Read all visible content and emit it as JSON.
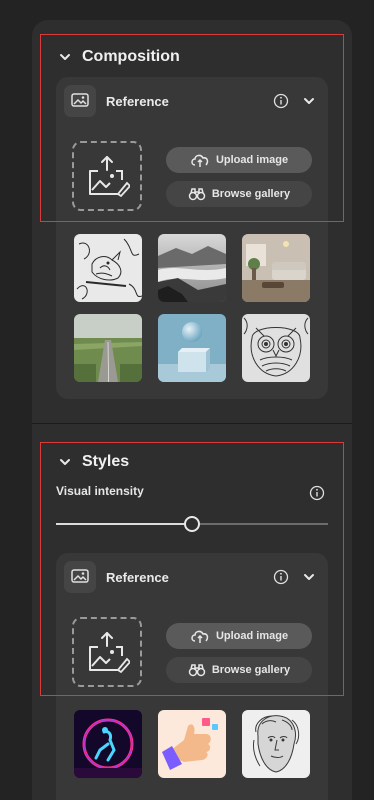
{
  "composition": {
    "title": "Composition",
    "reference": {
      "label": "Reference",
      "upload_label": "Upload image",
      "browse_label": "Browse gallery"
    },
    "thumbnails": [
      "bird-sketch",
      "misty-lake",
      "living-room",
      "country-road",
      "abstract-sphere",
      "owl-pattern"
    ]
  },
  "styles": {
    "title": "Styles",
    "intensity_label": "Visual intensity",
    "intensity_value": 0.5,
    "reference": {
      "label": "Reference",
      "upload_label": "Upload image",
      "browse_label": "Browse gallery"
    },
    "thumbnails": [
      "neon-figure",
      "thumbs-up-3d",
      "renaissance-portrait"
    ]
  },
  "colors": {
    "background": "#232323",
    "panel": "#2e2e2e",
    "card": "#383838",
    "highlight_box": "#d93a3a"
  }
}
